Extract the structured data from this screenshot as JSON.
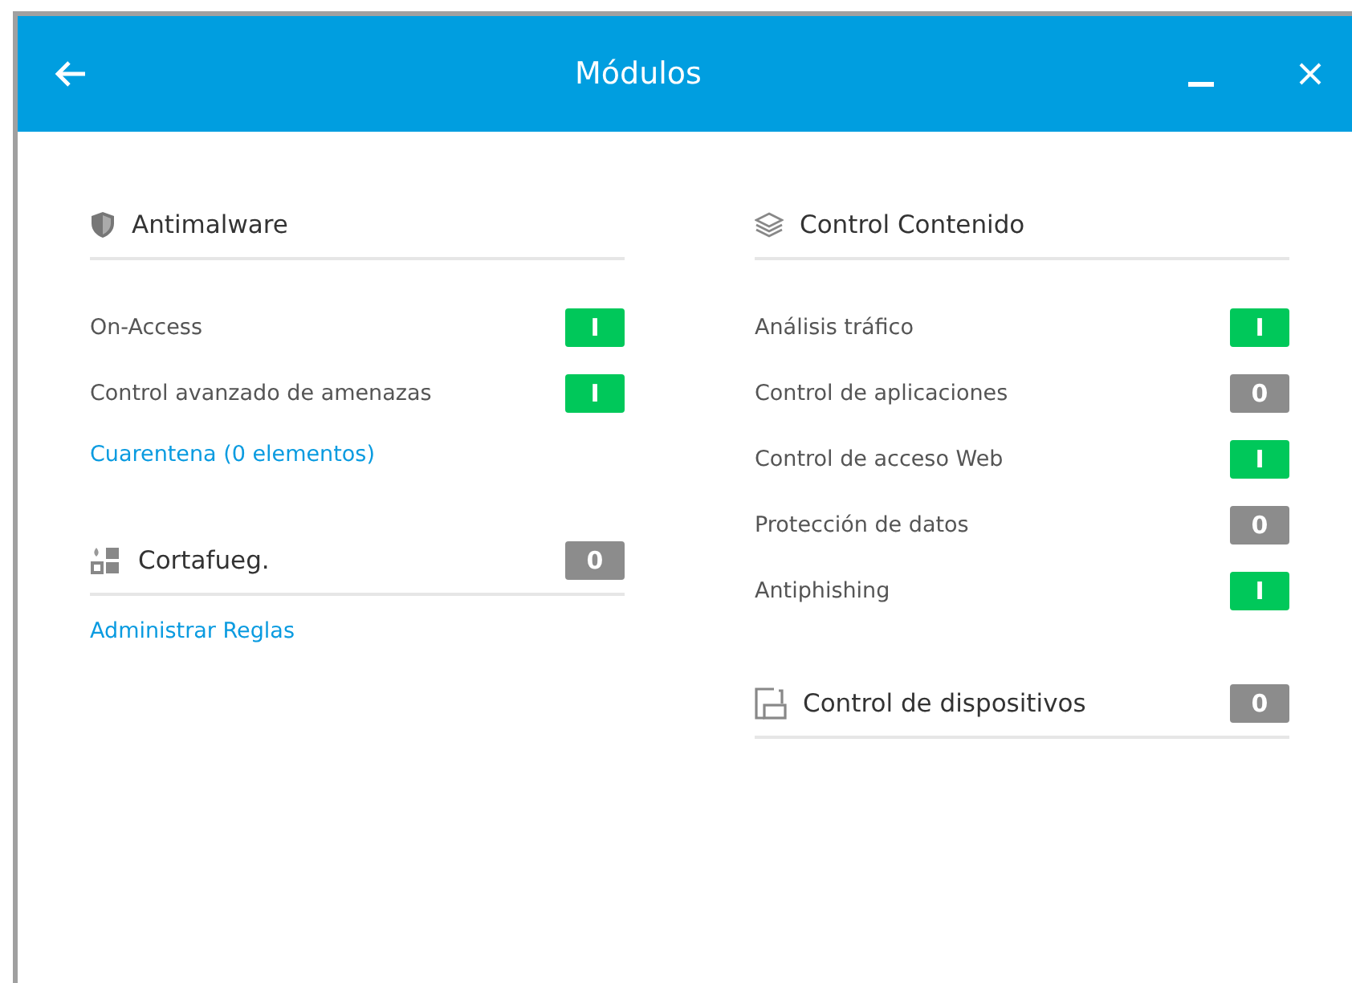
{
  "window": {
    "title": "Módulos"
  },
  "columns": [
    {
      "sections": [
        {
          "title": "Antimalware",
          "kind": "shield",
          "items": [
            {
              "label": "On-Access",
              "toggle": {
                "on": true,
                "label": "I"
              }
            },
            {
              "label": "Control avanzado de amenazas",
              "toggle": {
                "on": true,
                "label": "I"
              }
            }
          ],
          "links": [
            "Cuarentena (0 elementos)"
          ]
        },
        {
          "title": "Cortafueg.",
          "kind": "firewall",
          "toggle": {
            "on": false,
            "label": "0"
          },
          "links": [
            "Administrar Reglas"
          ]
        }
      ]
    },
    {
      "sections": [
        {
          "title": "Control Contenido",
          "kind": "layers",
          "items": [
            {
              "label": "Análisis tráfico",
              "toggle": {
                "on": true,
                "label": "I"
              }
            },
            {
              "label": "Control de aplicaciones",
              "toggle": {
                "on": false,
                "label": "0"
              }
            },
            {
              "label": "Control de acceso Web",
              "toggle": {
                "on": true,
                "label": "I"
              }
            },
            {
              "label": "Protección de datos",
              "toggle": {
                "on": false,
                "label": "0"
              }
            },
            {
              "label": "Antiphishing",
              "toggle": {
                "on": true,
                "label": "I"
              }
            }
          ]
        },
        {
          "title": "Control de dispositivos",
          "kind": "device",
          "toggle": {
            "on": false,
            "label": "0"
          }
        }
      ]
    }
  ]
}
